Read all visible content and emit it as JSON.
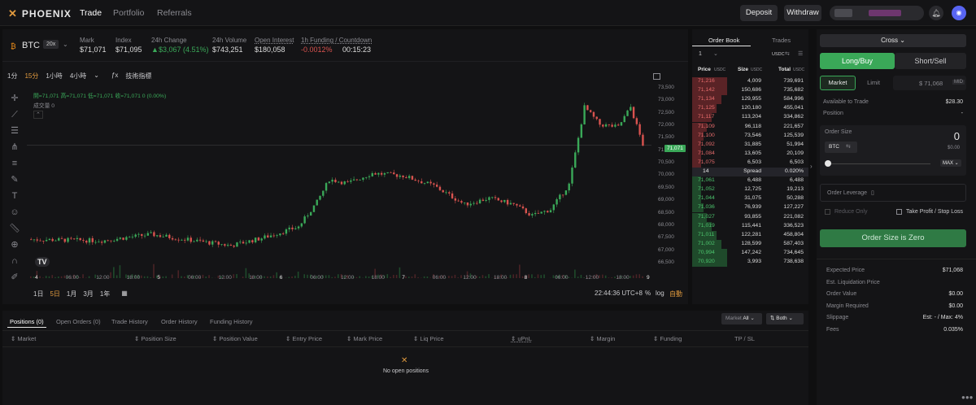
{
  "header": {
    "logo": "PHOENIX",
    "nav": [
      "Trade",
      "Portfolio",
      "Referrals"
    ],
    "deposit": "Deposit",
    "withdraw": "Withdraw"
  },
  "ticker": {
    "symbol": "BTC",
    "leverage": "20x",
    "stats": [
      {
        "label": "Mark",
        "value": "$71,071"
      },
      {
        "label": "Index",
        "value": "$71,095"
      },
      {
        "label": "24h Change",
        "value": "$3,067 (4.51%)"
      },
      {
        "label": "24h Volume",
        "value": "$743,251"
      },
      {
        "label": "Open Interest",
        "value": "$180,058"
      },
      {
        "label": "1h Funding / Countdown",
        "value": "-0.0012%",
        "value2": "00:15:23"
      }
    ]
  },
  "chart_toolbar": {
    "intervals": [
      "1分",
      "15分",
      "1小時",
      "4小時"
    ],
    "indicators": "技術指標",
    "ohlc": "開=71,071 高=71,071 低=71,071 收=71,071 0 (0.00%)",
    "volume": "成交量 0",
    "watermark": "TV"
  },
  "chart_axes": {
    "y": [
      "73,500",
      "73,000",
      "72,500",
      "72,000",
      "71,500",
      "71,000",
      "70,500",
      "70,000",
      "69,500",
      "69,000",
      "68,500",
      "68,000",
      "67,500",
      "67,000",
      "66,500"
    ],
    "x": [
      "4",
      "06:00",
      "12:00",
      "18:00",
      "5",
      "06:00",
      "12:00",
      "18:00",
      "6",
      "06:00",
      "12:00",
      "18:00",
      "7",
      "06:00",
      "12:00",
      "18:00",
      "8",
      "06:00",
      "12:00",
      "18:00",
      "9"
    ],
    "current_price": "71,071"
  },
  "range_bar": {
    "ranges": [
      "1日",
      "5日",
      "1月",
      "3月",
      "1年"
    ],
    "time": "22:44:36 UTC+8",
    "pct": "%",
    "log": "log",
    "auto": "自動"
  },
  "orderbook": {
    "tabs": [
      "Order Book",
      "Trades"
    ],
    "tick": "1",
    "unit": "USDC",
    "headers": {
      "price": "Price",
      "size": "Size",
      "total": "Total",
      "unit": "USDC"
    },
    "asks": [
      [
        "71,216",
        "4,009",
        "739,691"
      ],
      [
        "71,142",
        "150,686",
        "735,682"
      ],
      [
        "71,134",
        "129,955",
        "584,996"
      ],
      [
        "71,125",
        "120,180",
        "455,041"
      ],
      [
        "71,117",
        "113,204",
        "334,862"
      ],
      [
        "71,109",
        "96,118",
        "221,657"
      ],
      [
        "71,100",
        "73,546",
        "125,539"
      ],
      [
        "71,092",
        "31,885",
        "51,994"
      ],
      [
        "71,084",
        "13,605",
        "20,109"
      ],
      [
        "71,075",
        "6,503",
        "6,503"
      ]
    ],
    "spread": [
      "14",
      "Spread",
      "0.020%"
    ],
    "bids": [
      [
        "71,061",
        "6,488",
        "6,488"
      ],
      [
        "71,052",
        "12,725",
        "19,213"
      ],
      [
        "71,044",
        "31,075",
        "50,288"
      ],
      [
        "71,036",
        "76,939",
        "127,227"
      ],
      [
        "71,027",
        "93,855",
        "221,082"
      ],
      [
        "71,019",
        "115,441",
        "336,523"
      ],
      [
        "71,011",
        "122,281",
        "458,804"
      ],
      [
        "71,002",
        "128,599",
        "587,403"
      ],
      [
        "70,994",
        "147,242",
        "734,645"
      ],
      [
        "70,920",
        "3,993",
        "738,638"
      ]
    ]
  },
  "trade": {
    "margin_mode": "Cross",
    "long": "Long/Buy",
    "short": "Short/Sell",
    "market": "Market",
    "limit": "Limit",
    "price": "$ 71,068",
    "mid": "MID",
    "available_label": "Available to Trade",
    "available_value": "$28.30",
    "position_label": "Position",
    "position_value": "-",
    "order_size_label": "Order Size",
    "order_size_value": "0",
    "order_size_usd": "$0.00",
    "asset": "BTC",
    "max": "MAX",
    "order_leverage": "Order Leverage",
    "reduce_only": "Reduce Only",
    "tpsl": "Take Profit / Stop Loss",
    "submit": "Order Size is Zero",
    "summary": [
      {
        "label": "Expected Price",
        "value": "$71,068"
      },
      {
        "label": "Est. Liquidation Price",
        "value": ""
      },
      {
        "label": "Order Value",
        "value": "$0.00"
      },
      {
        "label": "Margin Required",
        "value": "$0.00"
      },
      {
        "label": "Slippage",
        "value": "Est: - / Max: 4%"
      },
      {
        "label": "Fees",
        "value": "0.035%"
      }
    ]
  },
  "bottom": {
    "tabs": [
      "Positions (0)",
      "Open Orders (0)",
      "Trade History",
      "Order History",
      "Funding History"
    ],
    "market_filter": "Market",
    "market_value": "All",
    "both": "Both",
    "columns": [
      "Market",
      "Position Size",
      "Position Value",
      "Entry Price",
      "Mark Price",
      "Liq Price",
      "uPnL",
      "Margin",
      "Funding",
      "TP / SL"
    ],
    "empty": "No open positions"
  },
  "colors": {
    "green": "#3aa858",
    "red": "#d9534f",
    "accent": "#e09a3e",
    "bg": "#0f0f10",
    "panel": "#141416"
  }
}
